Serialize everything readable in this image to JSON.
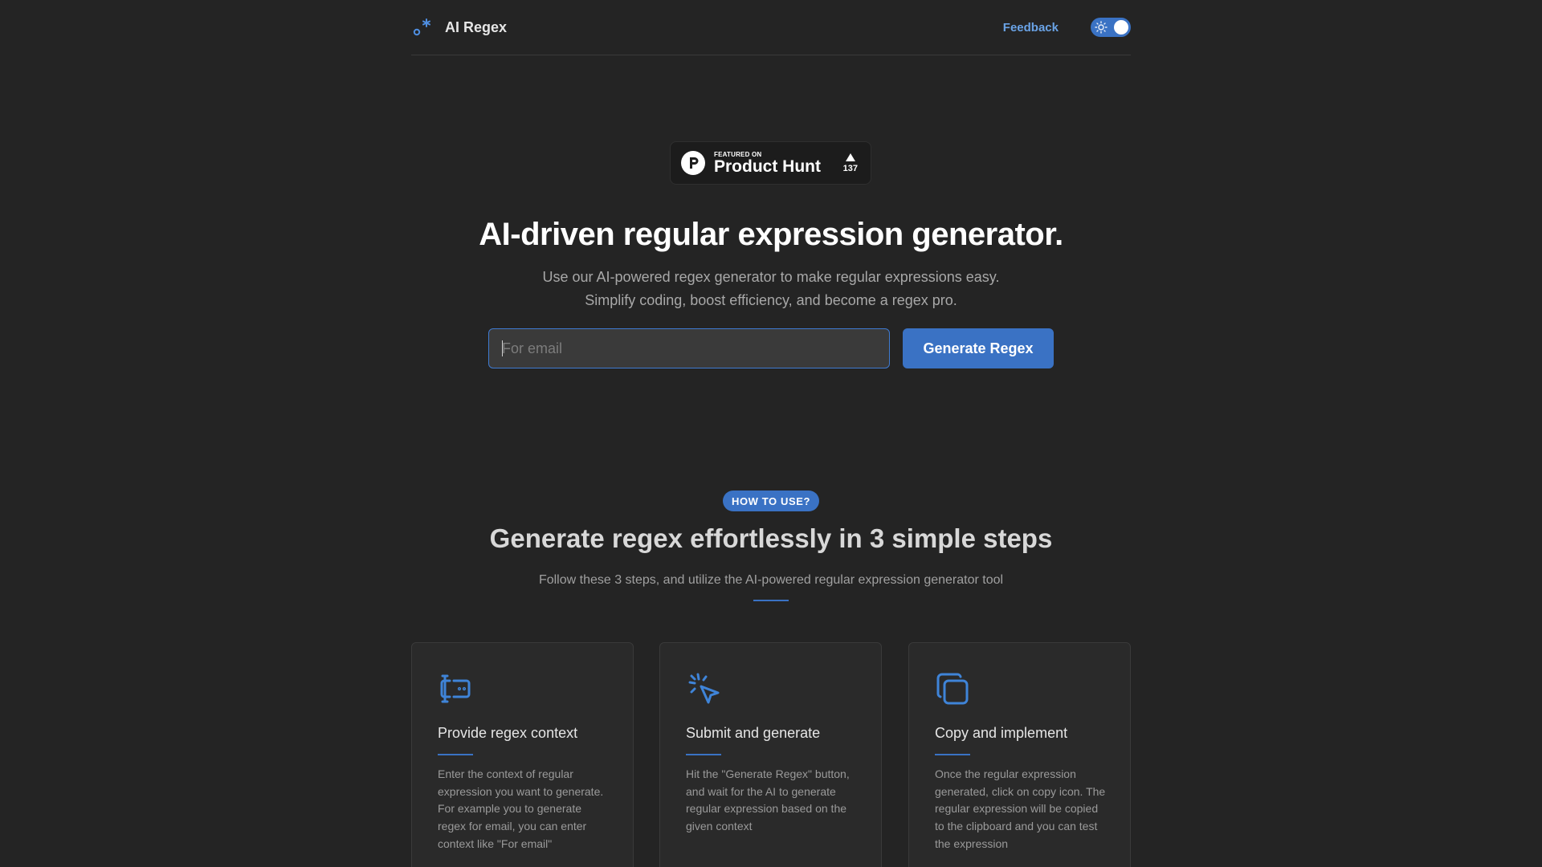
{
  "header": {
    "brand_name": "AI Regex",
    "feedback_label": "Feedback",
    "theme_toggle_icon": "sun-icon"
  },
  "product_hunt": {
    "featured_on": "FEATURED ON",
    "name": "Product Hunt",
    "upvote_count": "137"
  },
  "hero": {
    "title": "AI-driven regular expression generator.",
    "subtitle_line1": "Use our AI-powered regex generator to make regular expressions easy.",
    "subtitle_line2": "Simplify coding, boost efficiency, and become a regex pro.",
    "input_placeholder": "For email",
    "input_value": "",
    "generate_button": "Generate Regex"
  },
  "how_to_use": {
    "pill": "HOW TO USE?",
    "title": "Generate regex effortlessly in 3 simple steps",
    "subtitle": "Follow these 3 steps, and utilize the AI-powered regular expression generator tool",
    "steps": [
      {
        "icon": "text-cursor-input-icon",
        "title": "Provide regex context",
        "text": "Enter the context of regular expression you want to generate. For example you to generate regex for email, you can enter context like \"For email\""
      },
      {
        "icon": "pointer-click-icon",
        "title": "Submit and generate",
        "text": "Hit the \"Generate Regex\" button, and wait for the AI to generate regular expression based on the given context"
      },
      {
        "icon": "copy-icon",
        "title": "Copy and implement",
        "text": "Once the regular expression generated, click on copy icon. The regular expression will be copied to the clipboard and you can test the expression"
      }
    ]
  },
  "colors": {
    "accent": "#3a72c4",
    "background": "#242424",
    "link": "#6aa3e6"
  }
}
